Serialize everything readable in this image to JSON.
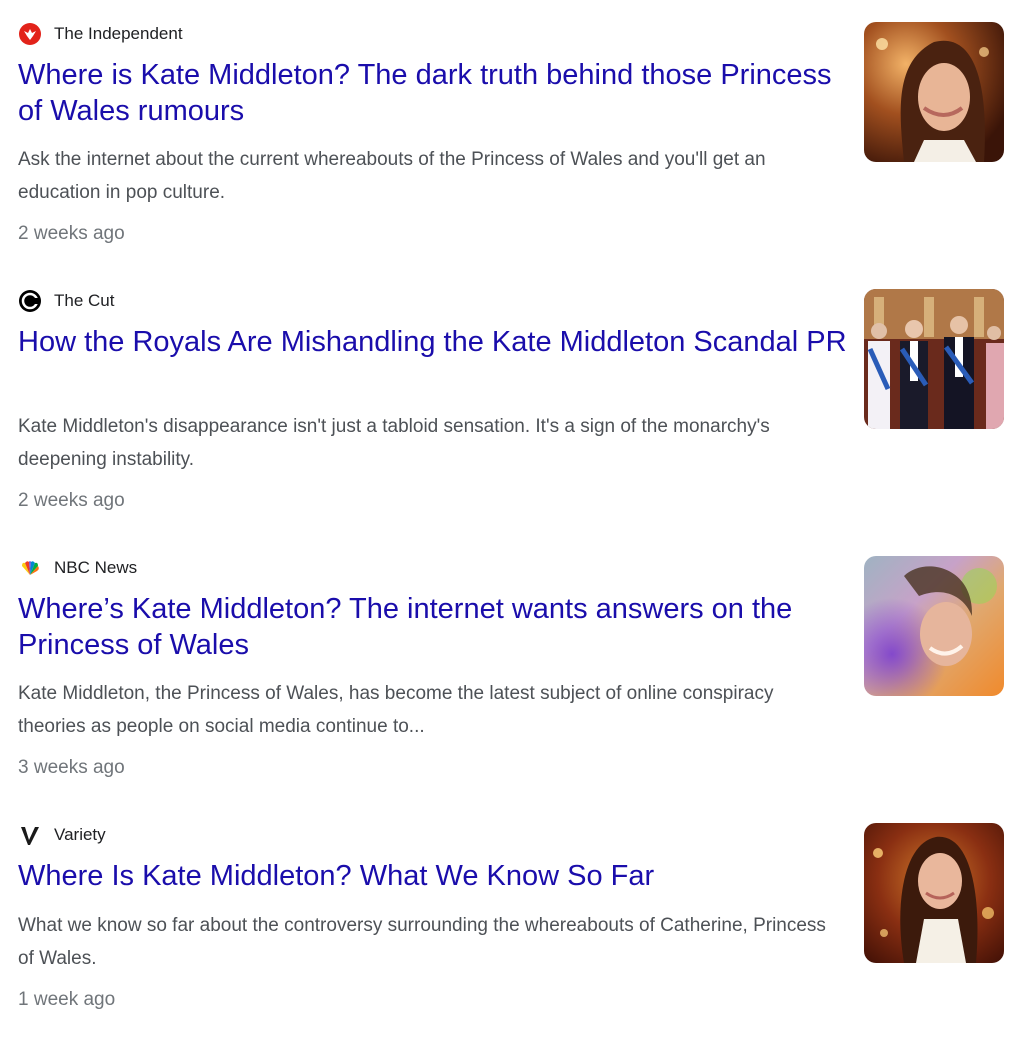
{
  "results": [
    {
      "source": "The Independent",
      "logo_icon": "independent-eagle-icon",
      "logo_color": "#e2231a",
      "headline": "Where is Kate Middleton? The dark truth behind those Princess of Wales rumours",
      "snippet": "Ask the internet about the current whereabouts of the Princess of Wales and you'll get an education in pop culture.",
      "age": "2 weeks ago",
      "thumbnail": "portrait-photo"
    },
    {
      "source": "The Cut",
      "logo_icon": "the-cut-c-icon",
      "logo_color": "#000000",
      "headline": "How the Royals Are Mishandling the Kate Middleton Scandal PR",
      "snippet": "Kate Middleton's disappearance isn't just a tabloid sensation. It's a sign of the monarchy's deepening instability.",
      "age": "2 weeks ago",
      "thumbnail": "group-photo"
    },
    {
      "source": "NBC News",
      "logo_icon": "nbc-peacock-icon",
      "headline": "Where’s Kate Middleton? The internet wants answers on the Princess of Wales",
      "snippet": "Kate Middleton, the Princess of Wales, has become the latest subject of online conspiracy theories as people on social media continue to...",
      "age": "3 weeks ago",
      "thumbnail": "blurred-portrait-photo"
    },
    {
      "source": "Variety",
      "logo_icon": "variety-v-icon",
      "logo_color": "#1a1a1a",
      "headline": "Where Is Kate Middleton? What We Know So Far",
      "snippet": "What we know so far about the controversy surrounding the whereabouts of Catherine, Princess of Wales.",
      "age": "1 week ago",
      "thumbnail": "portrait-photo"
    }
  ],
  "colors": {
    "headline": "#1a0dab",
    "snippet": "#4d5156",
    "age": "#70757a",
    "source": "#202124"
  }
}
